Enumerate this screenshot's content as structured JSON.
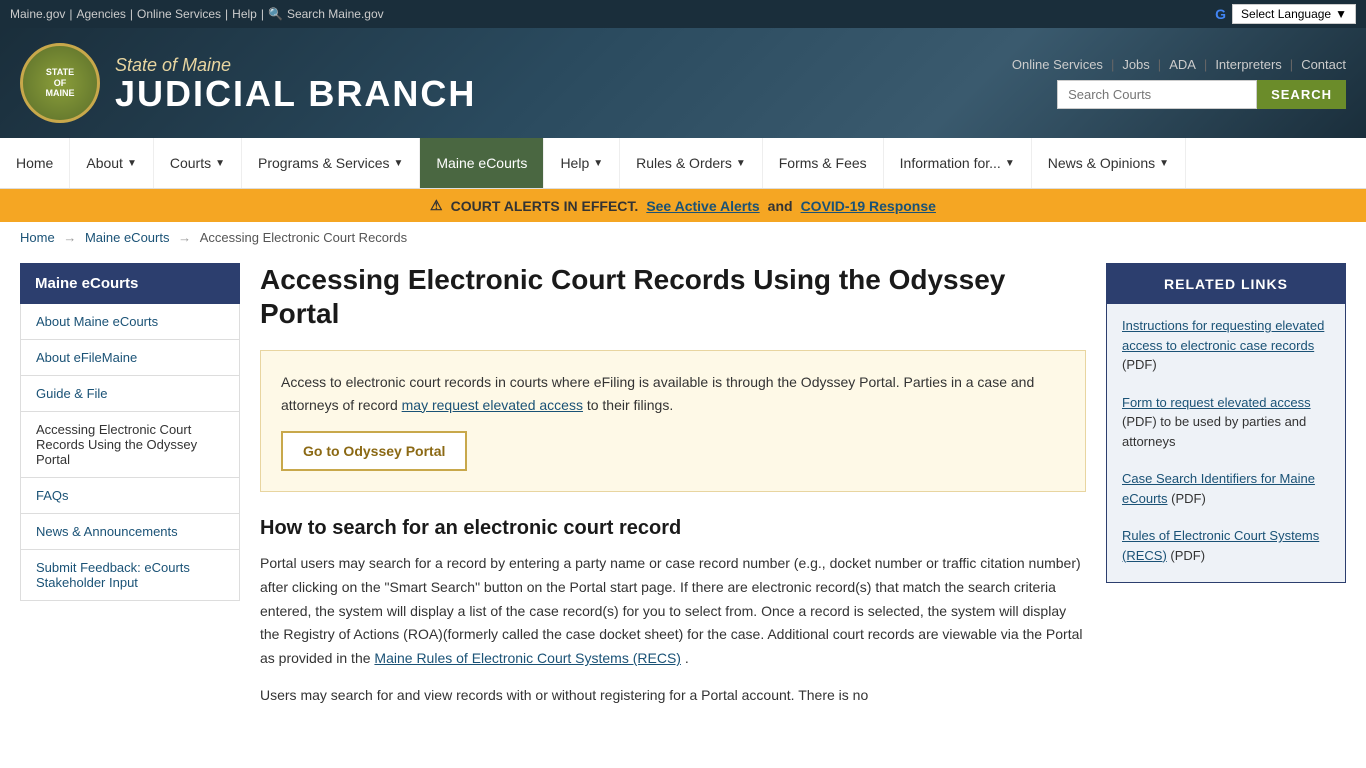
{
  "topbar": {
    "maine_gov": "Maine.gov",
    "agencies": "Agencies",
    "online_services": "Online Services",
    "help": "Help",
    "search_link": "Search Maine.gov",
    "select_language": "Select Language"
  },
  "header": {
    "state_name": "State of Maine",
    "branch_name": "JUDICIAL BRANCH",
    "seal_text": "STATE OF MAINE",
    "links": [
      "Online Services",
      "Jobs",
      "ADA",
      "Interpreters",
      "Contact"
    ],
    "search_placeholder": "Search Courts",
    "search_button": "SEARCH"
  },
  "nav": {
    "items": [
      {
        "label": "Home",
        "dropdown": false,
        "active": false
      },
      {
        "label": "About",
        "dropdown": true,
        "active": false
      },
      {
        "label": "Courts",
        "dropdown": true,
        "active": false
      },
      {
        "label": "Programs & Services",
        "dropdown": true,
        "active": false
      },
      {
        "label": "Maine eCourts",
        "dropdown": false,
        "active": true
      },
      {
        "label": "Help",
        "dropdown": true,
        "active": false
      },
      {
        "label": "Rules & Orders",
        "dropdown": true,
        "active": false
      },
      {
        "label": "Forms & Fees",
        "dropdown": false,
        "active": false
      },
      {
        "label": "Information for...",
        "dropdown": true,
        "active": false
      },
      {
        "label": "News & Opinions",
        "dropdown": true,
        "active": false
      }
    ]
  },
  "alert": {
    "icon": "⚠",
    "text": "COURT ALERTS IN EFFECT.",
    "link1_text": "See Active Alerts",
    "link1_url": "#",
    "and_text": "and",
    "link2_text": "COVID-19 Response",
    "link2_url": "#"
  },
  "breadcrumb": {
    "home": "Home",
    "ecourts": "Maine eCourts",
    "current": "Accessing Electronic Court Records"
  },
  "sidebar": {
    "title": "Maine eCourts",
    "items": [
      {
        "label": "About Maine eCourts",
        "active": false
      },
      {
        "label": "About eFileMaine",
        "active": false
      },
      {
        "label": "Guide & File",
        "active": false
      },
      {
        "label": "Accessing Electronic Court Records Using the Odyssey Portal",
        "active": true
      },
      {
        "label": "FAQs",
        "active": false
      },
      {
        "label": "News & Announcements",
        "active": false
      },
      {
        "label": "Submit Feedback: eCourts Stakeholder Input",
        "active": false
      }
    ]
  },
  "main": {
    "heading": "Accessing Electronic Court Records Using the Odyssey Portal",
    "intro_text": "Access to electronic court records in courts where eFiling is available is through the Odyssey Portal. Parties in a case and attorneys of record",
    "intro_link_text": "may request elevated access",
    "intro_link_url": "#",
    "intro_text2": "to their filings.",
    "portal_button": "Go to Odyssey Portal",
    "search_section_title": "How to search for an electronic court record",
    "search_description": "Portal users may search for a record by entering a party name or case record number (e.g., docket number or traffic citation number) after clicking on the \"Smart Search\" button on the Portal start page. If there are electronic record(s) that match the search criteria entered, the system will display a list of the case record(s) for you to select from. Once a record is selected, the system will display the Registry of Actions (ROA)(formerly called the case docket sheet) for the case. Additional court records are viewable via the Portal as provided in the",
    "search_link_text": "Maine Rules of Electronic Court Systems (RECS)",
    "search_link_url": "#",
    "search_description2": ".",
    "search_description3": "Users may search for and view records with or without registering for a Portal account. There is no"
  },
  "related_links": {
    "title": "RELATED LINKS",
    "items": [
      {
        "link_text": "Instructions for requesting elevated access to electronic case records",
        "link_url": "#",
        "suffix": "(PDF)"
      },
      {
        "link_text": "Form to request elevated access",
        "link_url": "#",
        "suffix": "(PDF) to be used by parties and attorneys"
      },
      {
        "link_text": "Case Search Identifiers for Maine eCourts",
        "link_url": "#",
        "suffix": "(PDF)"
      },
      {
        "link_text": "Rules of Electronic Court Systems (RECS)",
        "link_url": "#",
        "suffix": "(PDF)"
      }
    ]
  }
}
